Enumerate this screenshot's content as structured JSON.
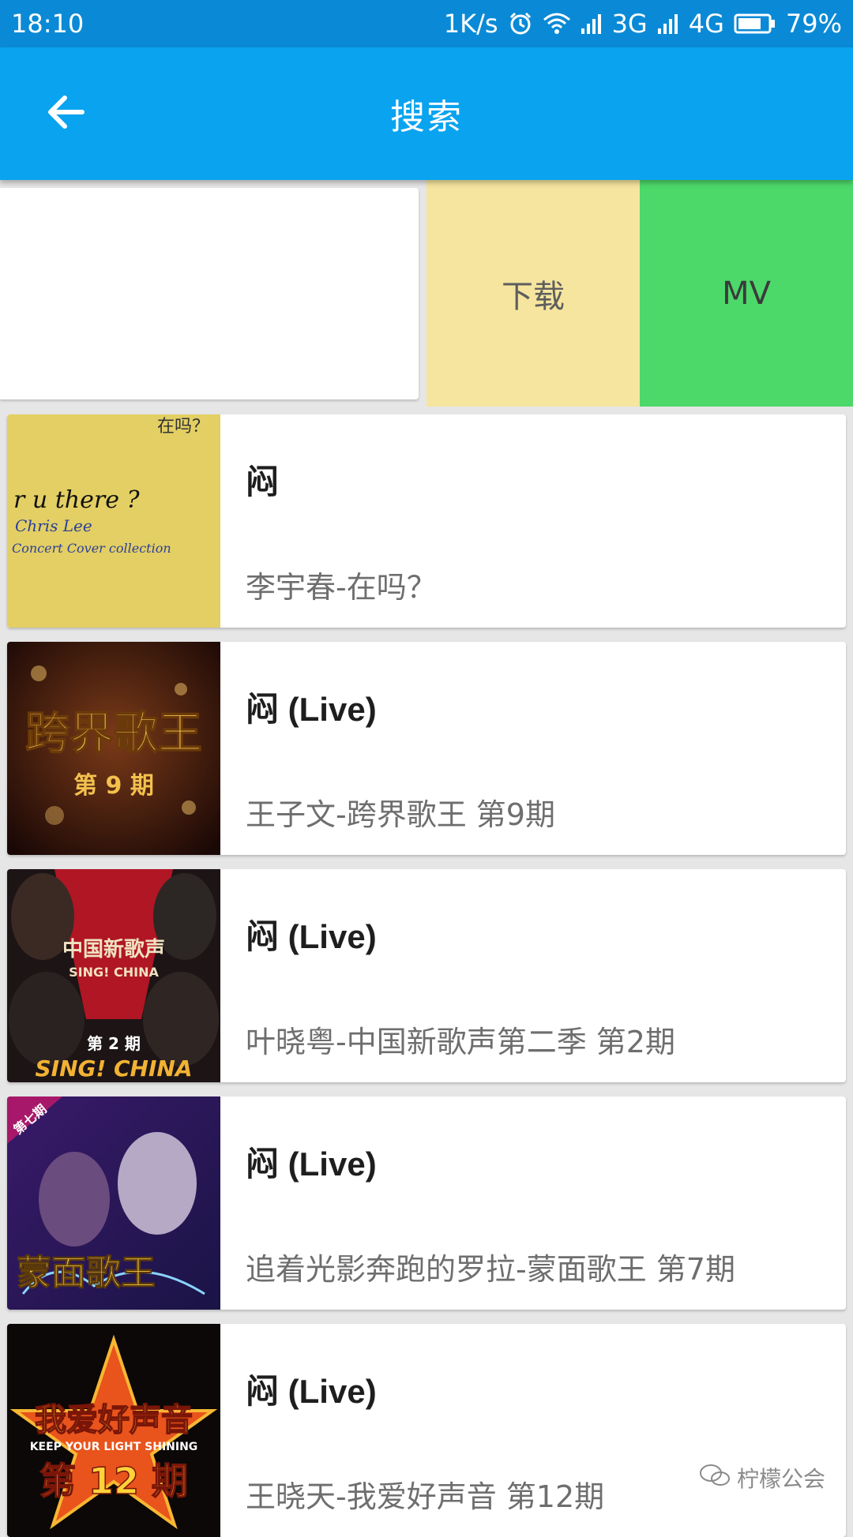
{
  "status_bar": {
    "time": "18:10",
    "net_speed": "1K/s",
    "sim1_type": "3G",
    "sim2_type": "4G",
    "battery": "79%",
    "battery_level": 0.79,
    "icons": [
      "alarm-icon",
      "wifi-icon",
      "signal-icon",
      "signal-icon",
      "battery-icon"
    ]
  },
  "app_bar": {
    "title": "搜索",
    "back_icon": "arrow-left-icon",
    "background": "#0aa3ef"
  },
  "swipe_actions": {
    "download_label": "下载",
    "mv_label": "MV",
    "download_color": "#f5e59f",
    "mv_color": "#4dd86a"
  },
  "results": [
    {
      "title": "闷",
      "subtitle": "李宇春-在吗？",
      "cover_lines": [
        "在吗？",
        "r u there ?",
        "Chris Lee",
        "Concert Cover collection"
      ]
    },
    {
      "title": "闷 (Live)",
      "subtitle": "王子文-跨界歌王 第9期",
      "cover_lines": [
        "跨界歌王",
        "第 9 期"
      ]
    },
    {
      "title": "闷 (Live)",
      "subtitle": "叶晓粤-中国新歌声第二季 第2期",
      "cover_lines": [
        "中国新歌声",
        "SING! CHINA",
        "第 2 期",
        "SING! CHINA"
      ]
    },
    {
      "title": "闷 (Live)",
      "subtitle": "追着光影奔跑的罗拉-蒙面歌王 第7期",
      "cover_lines": [
        "第七期",
        "蒙面歌王"
      ]
    },
    {
      "title": "闷 (Live)",
      "subtitle": "王晓天-我爱好声音 第12期",
      "cover_lines": [
        "我爱好声音",
        "KEEP YOUR LIGHT SHINING",
        "第 12 期"
      ]
    }
  ],
  "watermark": "柠檬公会"
}
